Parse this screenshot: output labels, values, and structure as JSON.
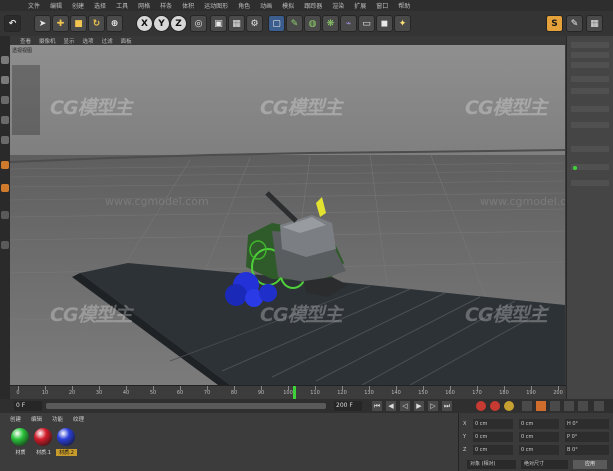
{
  "app": {
    "accent": "#e6a23a",
    "background": "#3a3a3a"
  },
  "menubar": {
    "items": [
      "文件",
      "编辑",
      "创建",
      "选择",
      "工具",
      "网格",
      "样条",
      "体积",
      "运动图形",
      "角色",
      "动画",
      "模拟",
      "跟踪器",
      "渲染",
      "扩展",
      "窗口",
      "帮助"
    ]
  },
  "toolbar": {
    "axis_x": "X",
    "axis_y": "Y",
    "axis_z": "Z"
  },
  "viewport": {
    "menu": [
      "查看",
      "摄像机",
      "显示",
      "选项",
      "过滤",
      "面板"
    ],
    "hud_label": "透视视图",
    "watermark": "CG模型主",
    "watermark_sub": "www.cgmodel.com"
  },
  "timeline": {
    "ticks": [
      "0",
      "10",
      "20",
      "30",
      "40",
      "50",
      "60",
      "70",
      "80",
      "90",
      "100",
      "110",
      "120",
      "130",
      "140",
      "150",
      "160",
      "170",
      "180",
      "190",
      "200"
    ],
    "current_frame": "0 F",
    "end_frame": "200 F"
  },
  "materials": {
    "menu": [
      "创建",
      "编辑",
      "功能",
      "纹理"
    ],
    "items": [
      {
        "name": "材质",
        "color": "#2bc43b"
      },
      {
        "name": "材质.1",
        "color": "#d21d2a"
      },
      {
        "name": "材质.2",
        "color": "#2b3fd8"
      }
    ]
  },
  "coordinates": {
    "rows": [
      {
        "axis": "X",
        "pos": "0 cm",
        "size": "0 cm",
        "rot": "H 0°"
      },
      {
        "axis": "Y",
        "pos": "0 cm",
        "size": "0 cm",
        "rot": "P 0°"
      },
      {
        "axis": "Z",
        "pos": "0 cm",
        "size": "0 cm",
        "rot": "B 0°"
      }
    ],
    "mode_label": "对象 (相对)",
    "size_label": "绝对尺寸",
    "apply_label": "应用"
  }
}
